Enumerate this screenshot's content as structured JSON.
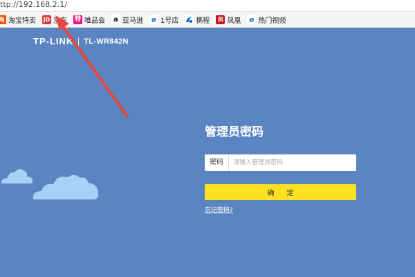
{
  "browser": {
    "url": "ttp://192.168.2.1/",
    "bookmarks": [
      {
        "label": "淘宝特卖",
        "icon": "taobao-icon",
        "glyph": "淘"
      },
      {
        "label": "京东",
        "icon": "jd-icon",
        "glyph": "JD"
      },
      {
        "label": "唯品会",
        "icon": "vip-icon",
        "glyph": "特"
      },
      {
        "label": "亚马逊",
        "icon": "amazon-icon",
        "glyph": "a"
      },
      {
        "label": "1号店",
        "icon": "ie-icon",
        "glyph": "e"
      },
      {
        "label": "携程",
        "icon": "ctrip-icon",
        "glyph": ""
      },
      {
        "label": "凤凰",
        "icon": "ifeng-icon",
        "glyph": "凤"
      },
      {
        "label": "热门视频",
        "icon": "ie-icon",
        "glyph": "e"
      }
    ]
  },
  "router": {
    "brand": "TP-LINK",
    "model": "TL-WR842N",
    "title": "管理员密码",
    "password_label": "密码",
    "password_placeholder": "请输入管理员密码",
    "password_value": "",
    "confirm_label": "确定",
    "forgot_label": "忘记密码?"
  },
  "colors": {
    "background": "#5b85c1",
    "button": "#fde021",
    "cloud": "#a9d0f5",
    "arrow": "#e8453c"
  }
}
